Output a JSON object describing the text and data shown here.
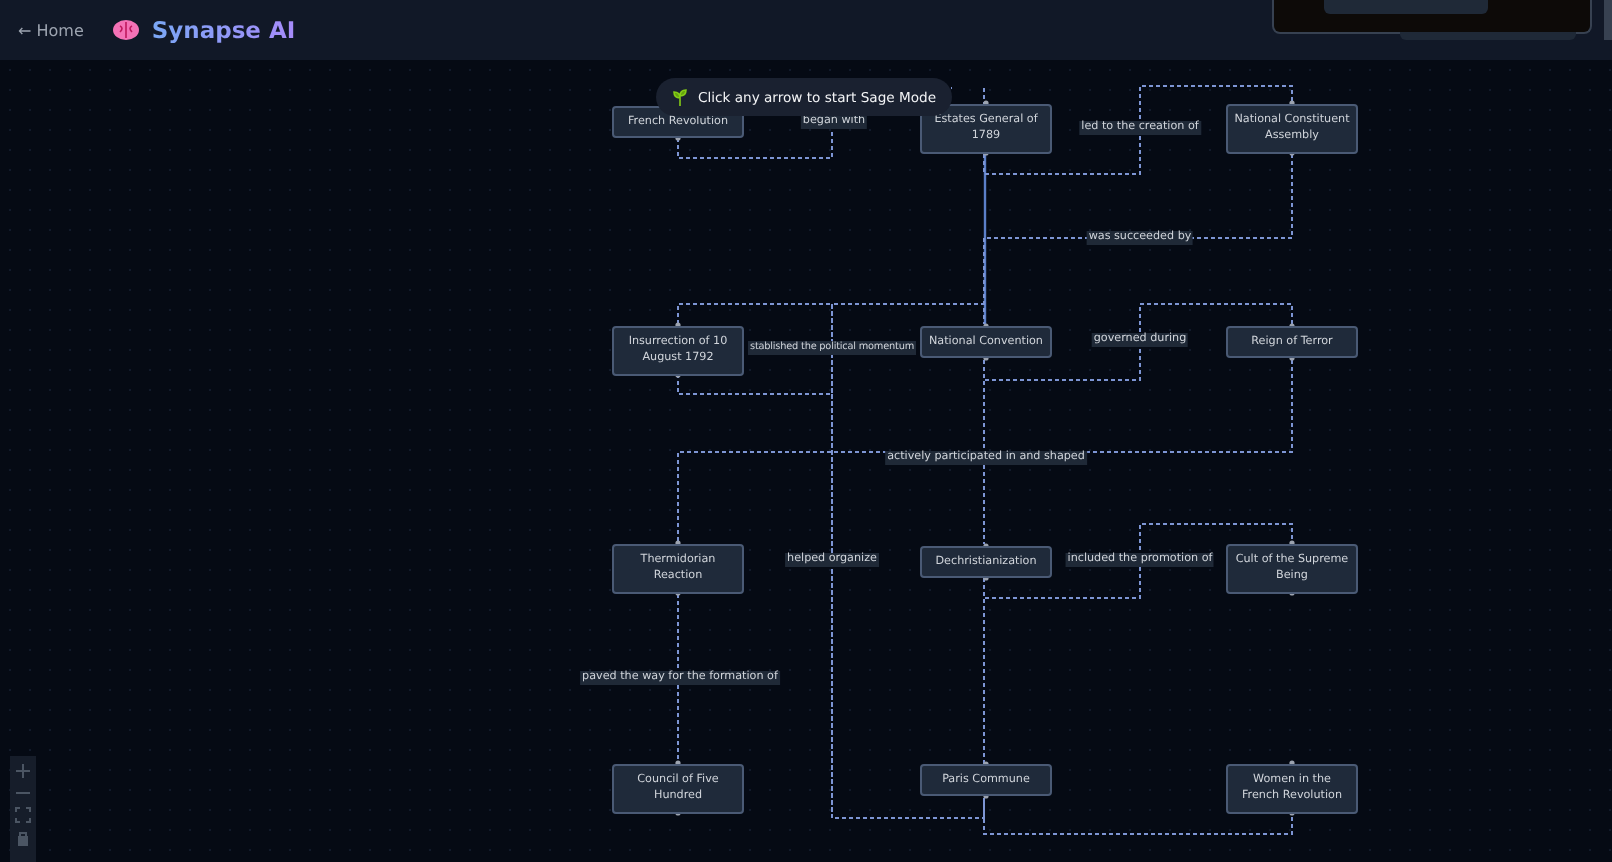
{
  "header": {
    "back_link": "← Home",
    "app_name": "Synapse AI"
  },
  "hint": "Click any arrow to start Sage Mode",
  "nodes": [
    {
      "label": "French Revolution"
    },
    {
      "label": "Estates General of 1789"
    },
    {
      "label": "National Constituent Assembly"
    },
    {
      "label": "Insurrection of 10 August 1792"
    },
    {
      "label": "National Convention"
    },
    {
      "label": "Reign of Terror"
    },
    {
      "label": "Thermidorian Reaction"
    },
    {
      "label": "Dechristianization"
    },
    {
      "label": "Cult of the Supreme Being"
    },
    {
      "label": "Council of Five Hundred"
    },
    {
      "label": "Paris Commune"
    },
    {
      "label": "Women in the French Revolution"
    }
  ],
  "edges": [
    {
      "label": "began with"
    },
    {
      "label": "led to the creation of"
    },
    {
      "label": "was succeeded by"
    },
    {
      "label": "stablished the political momentum"
    },
    {
      "label": "governed during"
    },
    {
      "label": "actively participated in and shaped"
    },
    {
      "label": "helped organize"
    },
    {
      "label": "included the promotion of"
    },
    {
      "label": "paved the way for the formation of"
    }
  ]
}
